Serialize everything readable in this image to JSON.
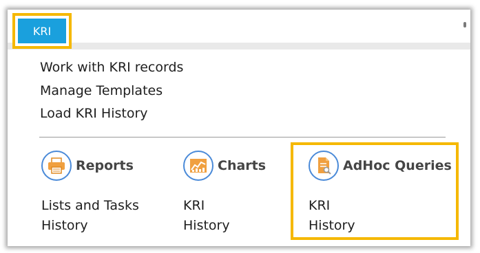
{
  "tab": {
    "label": "KRI"
  },
  "menu": {
    "items": [
      {
        "label": "Work with KRI records"
      },
      {
        "label": "Manage Templates"
      },
      {
        "label": "Load KRI History"
      }
    ]
  },
  "sections": [
    {
      "title": "Reports",
      "icon": "printer-icon",
      "links": [
        "Lists and Tasks",
        "History"
      ]
    },
    {
      "title": "Charts",
      "icon": "chart-icon",
      "links": [
        "KRI",
        "History"
      ]
    },
    {
      "title": "AdHoc Queries",
      "icon": "query-document-icon",
      "links": [
        "KRI",
        "History"
      ]
    }
  ],
  "colors": {
    "tab_blue": "#1aa0dd",
    "highlight": "#f5b800",
    "icon_ring": "#4a8ad8",
    "icon_fill": "#f0a040"
  }
}
